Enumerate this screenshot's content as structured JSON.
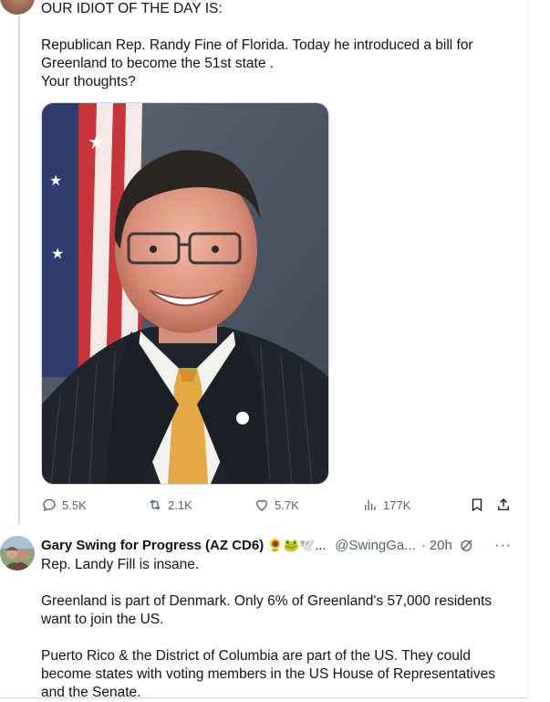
{
  "post": {
    "line1": "OUR IDIOT OF THE DAY IS:",
    "body": "Republican Rep. Randy Fine of Florida. Today he introduced a bill  for\nGreenland to become the 51st state .\nYour thoughts?",
    "media_alt": "Portrait of a man in a pinstripe suit with yellow tie in front of an American flag"
  },
  "actions": {
    "replies": "5.5K",
    "reposts": "2.1K",
    "likes": "5.7K",
    "views": "177K",
    "reply_icon": "reply-icon",
    "repost_icon": "repost-icon",
    "like_icon": "heart-icon",
    "views_icon": "analytics-icon",
    "bookmark_icon": "bookmark-icon",
    "share_icon": "share-icon"
  },
  "reply": {
    "name": "Gary Swing for Progress (AZ CD6)",
    "emojis": "🌻🐸🕊️...",
    "handle": "@SwingGa...",
    "time": "20h",
    "more": "···",
    "text1": "Rep. Landy Fill is insane.",
    "text2": "Greenland is part of Denmark. Only 6% of Greenland's 57,000 residents\nwant to join the US.",
    "text3": "Puerto Rico & the District of Columbia are part of the US. They could\nbecome states with voting members in the US House of Representatives\nand the Senate."
  },
  "colors": {
    "text": "#0f1419",
    "secondary": "#536471",
    "border": "#cfd9de"
  }
}
